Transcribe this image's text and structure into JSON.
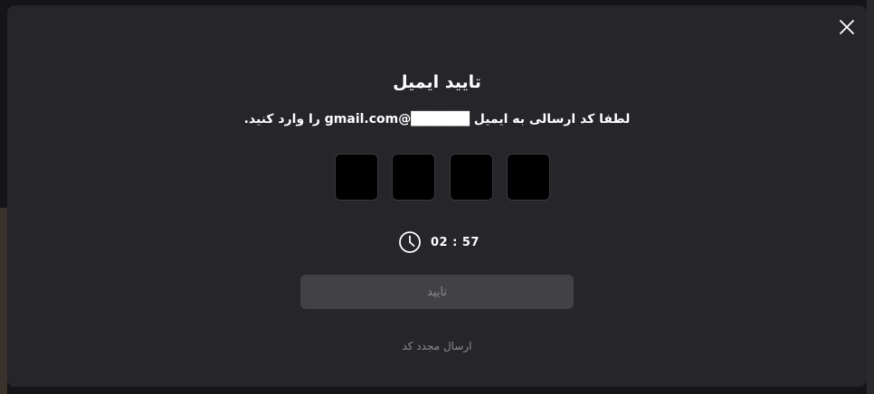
{
  "modal": {
    "title": "تایید ایمیل",
    "description": "لطفا کد ارسالی به ایمیل ██████@gmail.com را وارد کنید.",
    "otp": [
      "",
      "",
      "",
      ""
    ],
    "timer": "02 : 57",
    "confirm_label": "تایید",
    "resend_label": "ارسال مجدد کد"
  },
  "icons": {
    "close": "close-icon",
    "timer": "clock-icon"
  },
  "colors": {
    "modal_bg": "#25252a",
    "input_bg": "#000000",
    "button_disabled_bg": "#414146",
    "muted_text": "#8a8a90",
    "text": "#ffffff"
  }
}
